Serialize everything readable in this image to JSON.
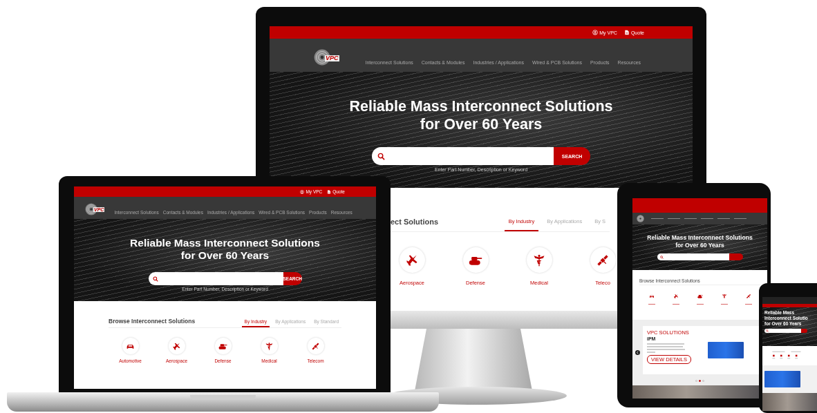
{
  "desktop": {
    "logo": "VPC",
    "top_links": [
      {
        "label": "My VPC",
        "kind": "user"
      },
      {
        "label": "Quote",
        "kind": "document"
      }
    ],
    "nav": [
      "Interconnect Solutions",
      "Contacts & Modules",
      "Industries / Applications",
      "Wired & PCB Solutions",
      "Products",
      "Resources"
    ],
    "hero_lines": [
      "Reliable Mass Interconnect Solutions",
      "for Over 60 Years"
    ],
    "search": {
      "button": "SEARCH",
      "hint": "Enter Part Number, Description or Keyword"
    },
    "browse": {
      "title": "ect Solutions",
      "tabs": [
        {
          "label": "By Industry",
          "selected": true
        },
        {
          "label": "By Applications",
          "selected": false
        },
        {
          "label": "By S",
          "selected": false
        }
      ],
      "categories": [
        {
          "label": "Aerospace",
          "kind": "jet"
        },
        {
          "label": "Defense",
          "kind": "tank"
        },
        {
          "label": "Medical",
          "kind": "caduceus"
        },
        {
          "label": "Teleco",
          "kind": "satellite"
        }
      ]
    }
  },
  "laptop": {
    "logo": "VPC",
    "top_links": [
      {
        "label": "My VPC",
        "kind": "user"
      },
      {
        "label": "Quote",
        "kind": "document"
      }
    ],
    "nav": [
      "Interconnect Solutions",
      "Contacts & Modules",
      "Industries / Applications",
      "Wired & PCB Solutions",
      "Products",
      "Resources"
    ],
    "hero_lines": [
      "Reliable Mass Interconnect Solutions",
      "for Over 60 Years"
    ],
    "search": {
      "button": "SEARCH",
      "hint": "Enter Part Number, Description or Keyword"
    },
    "browse": {
      "title": "Browse Interconnect Solutions",
      "tabs": [
        {
          "label": "By Industry",
          "selected": true
        },
        {
          "label": "By Applications",
          "selected": false
        },
        {
          "label": "By Standard",
          "selected": false
        }
      ],
      "categories": [
        {
          "label": "Automotive",
          "kind": "car"
        },
        {
          "label": "Aerospace",
          "kind": "jet"
        },
        {
          "label": "Defense",
          "kind": "tank"
        },
        {
          "label": "Medical",
          "kind": "caduceus"
        },
        {
          "label": "Telecom",
          "kind": "satellite"
        }
      ]
    }
  },
  "tablet": {
    "hero_lines": [
      "Reliable Mass Interconnect Solutions",
      "for Over 60 Years"
    ],
    "browse": {
      "title": "Browse Interconnect Solutions",
      "categories": [
        {
          "kind": "car"
        },
        {
          "kind": "jet"
        },
        {
          "kind": "tank"
        },
        {
          "kind": "caduceus"
        },
        {
          "kind": "satellite"
        }
      ]
    },
    "feature": {
      "eyebrow": "VPC SOLUTIONS",
      "title": "iPM",
      "button": "VIEW DETAILS"
    },
    "slides": [
      {
        "selected": false
      },
      {
        "selected": true
      },
      {
        "selected": false
      }
    ]
  },
  "phone": {
    "hero_lines": [
      "Reliable Mass Interconnect Solutio",
      "for Over 60 Years"
    ]
  }
}
